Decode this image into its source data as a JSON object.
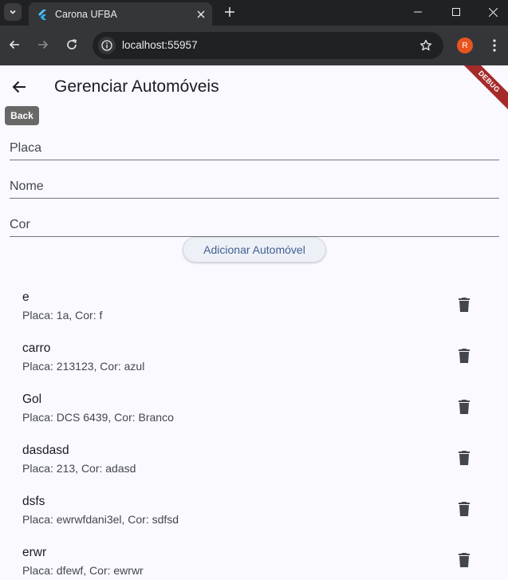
{
  "browser": {
    "tab_title": "Carona UFBA",
    "url": "localhost:55957",
    "profile_initial": "R"
  },
  "app": {
    "title": "Gerenciar Automóveis",
    "back_tooltip": "Back",
    "debug_banner": "DEBUG",
    "form": {
      "placa_label": "Placa",
      "nome_label": "Nome",
      "cor_label": "Cor",
      "add_button": "Adicionar Automóvel"
    },
    "cars": [
      {
        "name": "e",
        "details": "Placa: 1a, Cor: f"
      },
      {
        "name": "carro",
        "details": "Placa: 213123, Cor: azul"
      },
      {
        "name": "Gol",
        "details": "Placa: DCS 6439, Cor: Branco"
      },
      {
        "name": "dasdasd",
        "details": "Placa: 213, Cor: adasd"
      },
      {
        "name": "dsfs",
        "details": "Placa: ewrwfdani3el, Cor: sdfsd"
      },
      {
        "name": "erwr",
        "details": "Placa: dfewf, Cor: ewrwr"
      }
    ]
  },
  "colors": {
    "accent": "#415f91",
    "background": "#f9f9ff",
    "debug": "#a52a2a"
  }
}
